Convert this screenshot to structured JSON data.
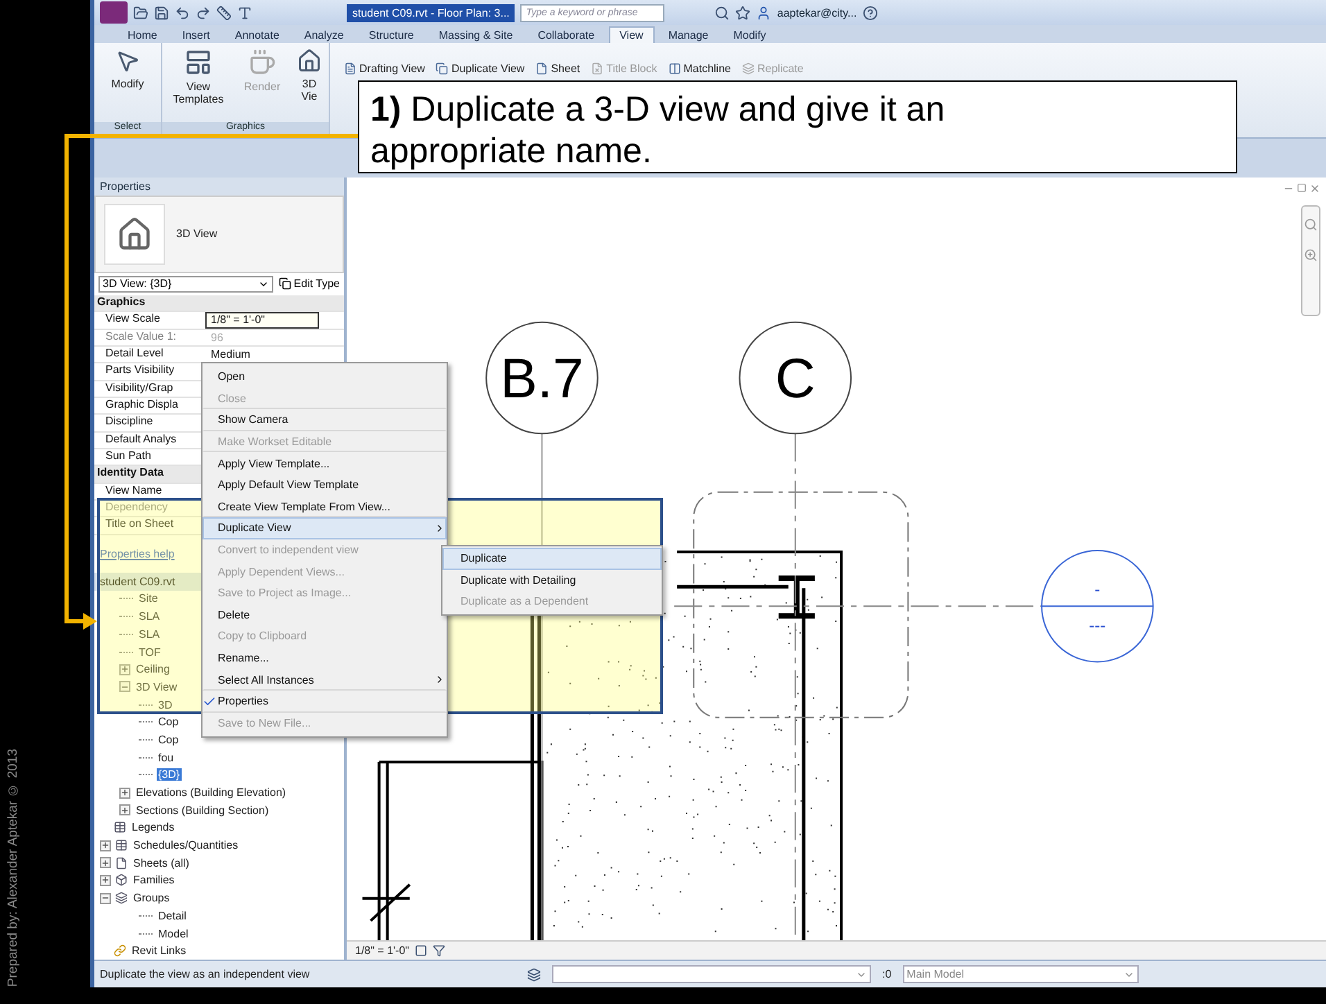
{
  "credit": "Prepared by: Alexander Aptekar © 2013",
  "title_bar": {
    "title": "student C09.rvt - Floor Plan: 3...",
    "search": {
      "placeholder": "Type a keyword or phrase"
    },
    "user": "aaptekar@city..."
  },
  "ribbon": {
    "tabs": [
      {
        "label": "Home",
        "selected": false
      },
      {
        "label": "Insert",
        "selected": false
      },
      {
        "label": "Annotate",
        "selected": false
      },
      {
        "label": "Analyze",
        "selected": false
      },
      {
        "label": "Structure",
        "selected": false
      },
      {
        "label": "Massing & Site",
        "selected": false
      },
      {
        "label": "Collaborate",
        "selected": false
      },
      {
        "label": "View",
        "selected": true
      },
      {
        "label": "Manage",
        "selected": false
      },
      {
        "label": "Modify",
        "selected": false
      }
    ],
    "large_buttons": [
      {
        "kind": "modify",
        "label": "Modify",
        "disabled": false
      },
      {
        "kind": "templates",
        "label": "View Templates",
        "disabled": false
      },
      {
        "kind": "render",
        "label": "Render",
        "disabled": true
      },
      {
        "kind": "view3d",
        "label": "3D Vie",
        "disabled": false
      }
    ],
    "small_buttons": [
      {
        "kind": "drafting",
        "label": "Drafting View",
        "disabled": false
      },
      {
        "kind": "duplicate",
        "label": "Duplicate View",
        "disabled": false
      },
      {
        "kind": "sheet",
        "label": "Sheet",
        "disabled": false
      },
      {
        "kind": "titleblock",
        "label": "Title Block",
        "disabled": true
      },
      {
        "kind": "matchline",
        "label": "Matchline",
        "disabled": false
      },
      {
        "kind": "replicate",
        "label": "Replicate",
        "disabled": true
      }
    ],
    "panel_labels": [
      "Select",
      "Graphics"
    ]
  },
  "callout": {
    "text": "**1)** Duplicate a 3-D view and give it an appropriate name."
  },
  "properties": {
    "title": "Properties",
    "type_name": "3D View",
    "type_selector": "3D View: {3D}",
    "edit_type": "Edit Type",
    "rows": [
      {
        "kind": "group",
        "label": "Graphics"
      },
      {
        "kind": "param",
        "label": "View Scale",
        "value": "1/8\" = 1'-0\"",
        "disabled": false,
        "editing": true
      },
      {
        "kind": "param",
        "label": "Scale Value    1:",
        "value": "96",
        "disabled": true,
        "editing": false
      },
      {
        "kind": "param",
        "label": "Detail Level",
        "value": "Medium",
        "disabled": false,
        "editing": false
      },
      {
        "kind": "param",
        "label": "Parts Visibility",
        "disabled": false
      },
      {
        "kind": "param",
        "label": "Visibility/Grap",
        "disabled": false
      },
      {
        "kind": "param",
        "label": "Graphic Displa",
        "disabled": false
      },
      {
        "kind": "param",
        "label": "Discipline",
        "disabled": false
      },
      {
        "kind": "param",
        "label": "Default Analys",
        "disabled": false
      },
      {
        "kind": "param",
        "label": "Sun Path",
        "disabled": false
      },
      {
        "kind": "group",
        "label": "Identity Data"
      },
      {
        "kind": "param",
        "label": "View Name",
        "disabled": false
      },
      {
        "kind": "param",
        "label": "Dependency",
        "disabled": true
      },
      {
        "kind": "param",
        "label": "Title on Sheet",
        "disabled": false
      }
    ],
    "help_link": "Properties help"
  },
  "project_browser": {
    "root": "student C09.rvt",
    "items": [
      {
        "kind": "view",
        "label": "Site",
        "selected": false
      },
      {
        "kind": "view",
        "label": "SLA",
        "selected": false
      },
      {
        "kind": "view",
        "label": "SLA",
        "selected": false
      },
      {
        "kind": "view",
        "label": "TOF",
        "selected": false
      },
      {
        "kind": "folder",
        "label": "Ceiling",
        "selected": false,
        "expanded": false
      },
      {
        "kind": "folder",
        "label": "3D View",
        "selected": false,
        "expanded": true,
        "children": [
          {
            "kind": "view",
            "label": "3D",
            "selected": false
          },
          {
            "kind": "view",
            "label": "Cop",
            "selected": false
          },
          {
            "kind": "view",
            "label": "Cop",
            "selected": false
          },
          {
            "kind": "view",
            "label": "fou",
            "selected": false
          },
          {
            "kind": "view",
            "label": "{3D}",
            "selected": true
          }
        ]
      },
      {
        "kind": "folder",
        "label": "Elevations (Building Elevation)",
        "selected": false,
        "expanded": false
      },
      {
        "kind": "folder",
        "label": "Sections (Building Section)",
        "selected": false,
        "expanded": false
      },
      {
        "kind": "legends",
        "label": "Legends",
        "selected": false
      },
      {
        "kind": "schedules",
        "label": "Schedules/Quantities",
        "selected": false,
        "expanded": false
      },
      {
        "kind": "sheets",
        "label": "Sheets (all)",
        "selected": false,
        "expanded": false
      },
      {
        "kind": "families",
        "label": "Families",
        "selected": false,
        "expanded": false
      },
      {
        "kind": "groups",
        "label": "Groups",
        "selected": false,
        "expanded": true,
        "children": [
          {
            "kind": "view",
            "label": "Detail",
            "selected": false
          },
          {
            "kind": "view",
            "label": "Model",
            "selected": false
          }
        ]
      },
      {
        "kind": "links",
        "label": "Revit Links",
        "selected": false
      }
    ]
  },
  "context_menu": {
    "items": [
      {
        "label": "Open",
        "disabled": false,
        "selected": false,
        "checked": false,
        "has_submenu": false,
        "separator_after": false
      },
      {
        "label": "Close",
        "disabled": true,
        "selected": false,
        "checked": false,
        "has_submenu": false,
        "separator_after": true
      },
      {
        "label": "Show Camera",
        "disabled": false,
        "selected": false,
        "checked": false,
        "has_submenu": false,
        "separator_after": true
      },
      {
        "label": "Make Workset Editable",
        "disabled": true,
        "selected": false,
        "checked": false,
        "has_submenu": false,
        "separator_after": true
      },
      {
        "label": "Apply View Template...",
        "disabled": false,
        "selected": false,
        "checked": false,
        "has_submenu": false,
        "separator_after": false
      },
      {
        "label": "Apply Default View Template",
        "disabled": false,
        "selected": false,
        "checked": false,
        "has_submenu": false,
        "separator_after": false
      },
      {
        "label": "Create View Template From View...",
        "disabled": false,
        "selected": false,
        "checked": false,
        "has_submenu": false,
        "separator_after": true
      },
      {
        "label": "Duplicate View",
        "disabled": false,
        "selected": true,
        "checked": false,
        "has_submenu": true,
        "separator_after": false
      },
      {
        "label": "Convert to independent view",
        "disabled": true,
        "selected": false,
        "checked": false,
        "has_submenu": false,
        "separator_after": false
      },
      {
        "label": "Apply Dependent Views...",
        "disabled": true,
        "selected": false,
        "checked": false,
        "has_submenu": false,
        "separator_after": false
      },
      {
        "label": "Save to Project as Image...",
        "disabled": true,
        "selected": false,
        "checked": false,
        "has_submenu": false,
        "separator_after": false
      },
      {
        "label": "Delete",
        "disabled": false,
        "selected": false,
        "checked": false,
        "has_submenu": false,
        "separator_after": false
      },
      {
        "label": "Copy to Clipboard",
        "disabled": true,
        "selected": false,
        "checked": false,
        "has_submenu": false,
        "separator_after": false
      },
      {
        "label": "Rename...",
        "disabled": false,
        "selected": false,
        "checked": false,
        "has_submenu": false,
        "separator_after": false
      },
      {
        "label": "Select All Instances",
        "disabled": false,
        "selected": false,
        "checked": false,
        "has_submenu": true,
        "separator_after": true
      },
      {
        "label": "Properties",
        "disabled": false,
        "selected": false,
        "checked": true,
        "has_submenu": false,
        "separator_after": true
      },
      {
        "label": "Save to New File...",
        "disabled": true,
        "selected": false,
        "checked": false,
        "has_submenu": false,
        "separator_after": false
      }
    ]
  },
  "submenu": {
    "items": [
      {
        "label": "Duplicate",
        "disabled": false,
        "selected": true
      },
      {
        "label": "Duplicate with Detailing",
        "disabled": false,
        "selected": false
      },
      {
        "label": "Duplicate as a Dependent",
        "disabled": true,
        "selected": false
      }
    ]
  },
  "canvas": {
    "grid_bubbles": [
      {
        "label": "B.7"
      },
      {
        "label": "C"
      }
    ],
    "section_marker": {
      "top": "-",
      "bottom": "---"
    },
    "view_scale": "1/8\" = 1'-0\""
  },
  "status_bar": {
    "message": "Duplicate the view as an independent view",
    "selection_count": ":0",
    "workset": "Main Model"
  }
}
